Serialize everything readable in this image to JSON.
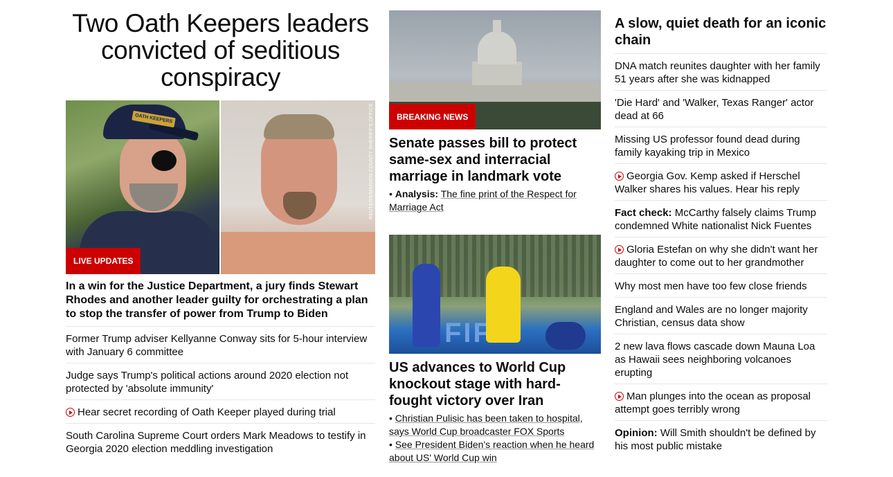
{
  "col1": {
    "headline": "Two Oath Keepers leaders convicted of seditious conspiracy",
    "image_credit": "REUTERS/MARION COUNTY SHERIFF'S OFFICE",
    "cap_text": "OATH KEEPERS",
    "badge": "LIVE UPDATES",
    "lede": "In a win for the Justice Department, a jury finds Stewart Rhodes and another leader guilty for orchestrating a plan to stop the transfer of power from Trump to Biden",
    "items": [
      {
        "text": "Former Trump adviser Kellyanne Conway sits for 5-hour interview with January 6 committee",
        "video": false
      },
      {
        "text": "Judge says Trump's political actions around 2020 election not protected by 'absolute immunity'",
        "video": false
      },
      {
        "text": "Hear secret recording of Oath Keeper played during trial",
        "video": true
      },
      {
        "text": "South Carolina Supreme Court orders Mark Meadows to testify in Georgia 2020 election meddling investigation",
        "video": false
      }
    ]
  },
  "col2": {
    "story1": {
      "badge": "BREAKING NEWS",
      "headline": "Senate passes bill to protect same-sex and interracial marriage in landmark vote",
      "bullet_label": "Analysis:",
      "bullet_text": "The fine print of the Respect for Marriage Act"
    },
    "story2": {
      "headline": "US advances to World Cup knockout stage with hard-fought victory over Iran",
      "board_text": "FIFA",
      "bullets": [
        "Christian Pulisic has been taken to hospital, says World Cup broadcaster FOX Sports",
        "See President Biden's reaction when he heard about US' World Cup win"
      ]
    }
  },
  "col3": {
    "title": "A slow, quiet death for an iconic chain",
    "items": [
      {
        "label": "",
        "text": "DNA match reunites daughter with her family 51 years after she was kidnapped",
        "video": false
      },
      {
        "label": "",
        "text": "'Die Hard' and 'Walker, Texas Ranger' actor dead at 66",
        "video": false
      },
      {
        "label": "",
        "text": "Missing US professor found dead during family kayaking trip in Mexico",
        "video": false
      },
      {
        "label": "",
        "text": "Georgia Gov. Kemp asked if Herschel Walker shares his values. Hear his reply",
        "video": true
      },
      {
        "label": "Fact check:",
        "text": "McCarthy falsely claims Trump condemned White nationalist Nick Fuentes",
        "video": false
      },
      {
        "label": "",
        "text": "Gloria Estefan on why she didn't want her daughter to come out to her grandmother",
        "video": true
      },
      {
        "label": "",
        "text": "Why most men have too few close friends",
        "video": false
      },
      {
        "label": "",
        "text": "England and Wales are no longer majority Christian, census data show",
        "video": false
      },
      {
        "label": "",
        "text": "2 new lava flows cascade down Mauna Loa as Hawaii sees neighboring volcanoes erupting",
        "video": false
      },
      {
        "label": "",
        "text": "Man plunges into the ocean as proposal attempt goes terribly wrong",
        "video": true
      },
      {
        "label": "Opinion:",
        "text": "Will Smith shouldn't be defined by his most public mistake",
        "video": false
      }
    ]
  },
  "colors": {
    "accent": "#cc0000",
    "divider": "#e6e6e6",
    "text": "#0c0c0c"
  }
}
